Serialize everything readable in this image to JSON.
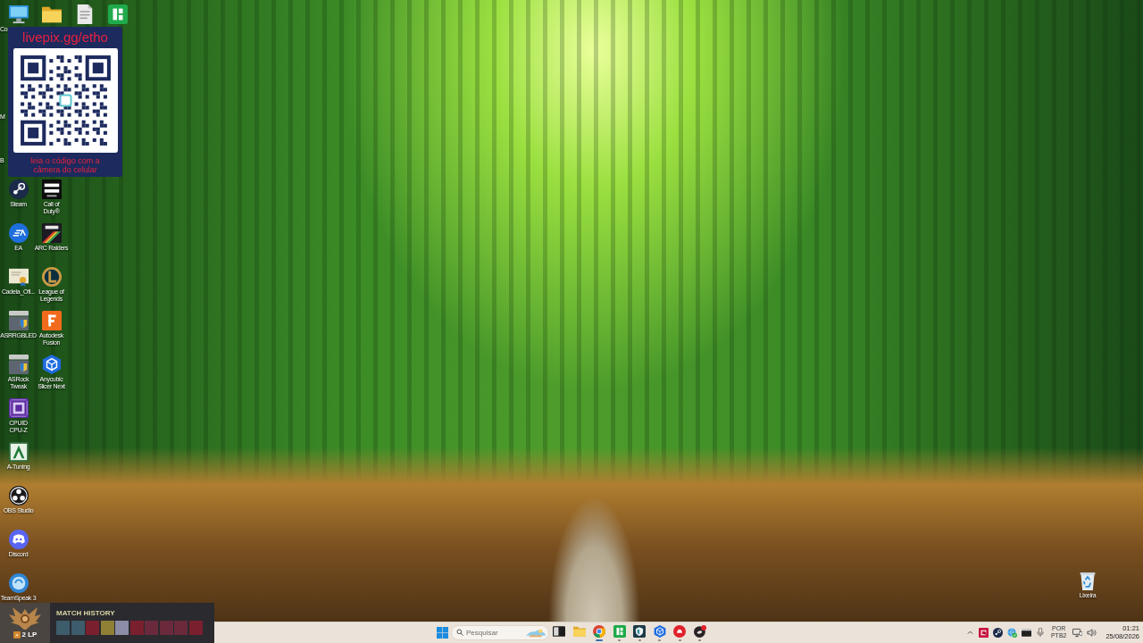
{
  "desktop_icons": [
    {
      "label": "Co"
    },
    {
      "label": "M"
    },
    {
      "label": "B"
    },
    {
      "label": "Steam"
    },
    {
      "label": "EA"
    },
    {
      "label": "Cadeia_Ofi..."
    },
    {
      "label": "ASRRGBLED"
    },
    {
      "label": "ASRock\nTweak"
    },
    {
      "label": "CPUID\nCPU-Z"
    },
    {
      "label": "A-Tuning"
    },
    {
      "label": "OBS Studio"
    },
    {
      "label": "Discord"
    },
    {
      "label": "TeamSpeak 3"
    },
    {
      "label": "Call of\nDuty®"
    },
    {
      "label": "ARC Raiders"
    },
    {
      "label": "League of\nLegends"
    },
    {
      "label": "Autodesk\nFusion"
    },
    {
      "label": "Anycubic\nSlicer Next"
    },
    {
      "label": "Lixeira"
    }
  ],
  "donation_overlay": {
    "link": "livepix.gg/etho",
    "caption": "leia o código com a câmera do celular"
  },
  "match_history": {
    "title": "MATCH HISTORY",
    "league_points": "2 LP"
  },
  "taskbar": {
    "search": {
      "placeholder": "Pesquisar"
    },
    "apps": [
      {
        "running": false,
        "selected": false
      },
      {
        "running": false,
        "selected": false
      },
      {
        "running": true,
        "selected": true
      },
      {
        "running": true,
        "selected": false
      },
      {
        "running": true,
        "selected": false
      },
      {
        "running": true,
        "selected": false
      },
      {
        "running": true,
        "selected": false
      },
      {
        "running": true,
        "selected": false
      }
    ],
    "language": [
      "POR",
      "PTB2"
    ],
    "clock": {
      "time": "01:21",
      "date": "25/08/2026"
    }
  }
}
